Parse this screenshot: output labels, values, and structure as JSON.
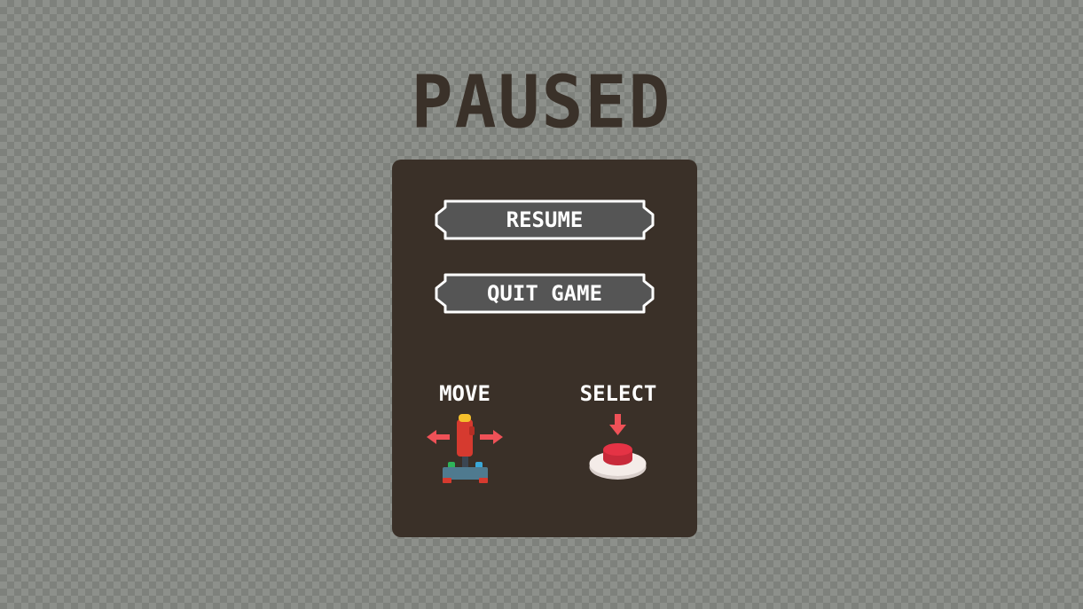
{
  "screen": {
    "title": "PAUSED"
  },
  "menu": {
    "resume_label": "RESUME",
    "quit_label": "QUIT GAME"
  },
  "controls": {
    "move_label": "MOVE",
    "move_icon": "joystick-icon",
    "select_label": "SELECT",
    "select_icon": "push-button-icon"
  },
  "colors": {
    "panel": "#3a3028",
    "button_fill": "#555555",
    "button_border": "#ffffff",
    "arrow": "#ef5157",
    "title": "#3a3129"
  }
}
